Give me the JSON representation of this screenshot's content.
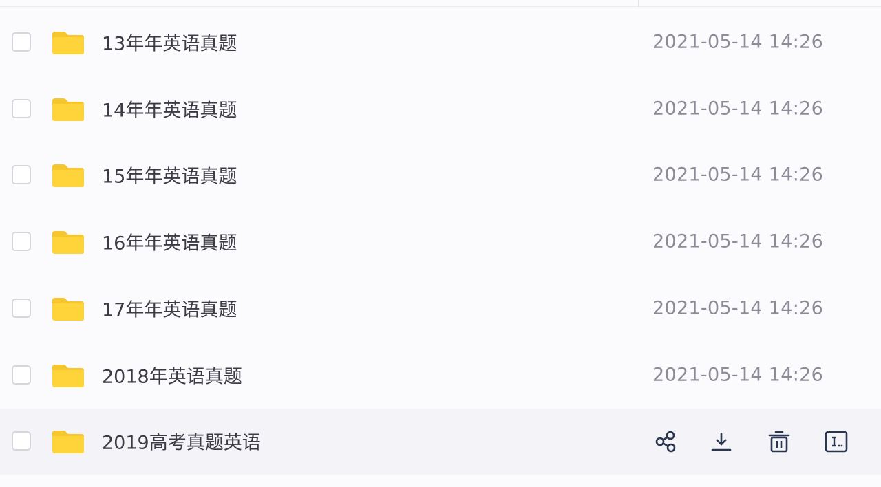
{
  "colors": {
    "folder": "#FFD43B",
    "folder_tab": "#F7C52E",
    "icon": "#2a3550",
    "name_text": "#3b3b45",
    "date_text": "#8c8c98"
  },
  "files": [
    {
      "name": "13年年英语真题",
      "date": "2021-05-14 14:26",
      "icon": "folder-icon"
    },
    {
      "name": "14年年英语真题",
      "date": "2021-05-14 14:26",
      "icon": "folder-icon"
    },
    {
      "name": "15年年英语真题",
      "date": "2021-05-14 14:26",
      "icon": "folder-icon"
    },
    {
      "name": "16年年英语真题",
      "date": "2021-05-14 14:26",
      "icon": "folder-icon"
    },
    {
      "name": "17年年英语真题",
      "date": "2021-05-14 14:26",
      "icon": "folder-icon"
    },
    {
      "name": "2018年英语真题",
      "date": "2021-05-14 14:26",
      "icon": "folder-icon"
    },
    {
      "name": "2019高考真题英语",
      "date": "",
      "icon": "folder-icon",
      "hovered": true
    }
  ],
  "row_actions": [
    "share-icon",
    "download-icon",
    "delete-icon",
    "rename-icon"
  ]
}
